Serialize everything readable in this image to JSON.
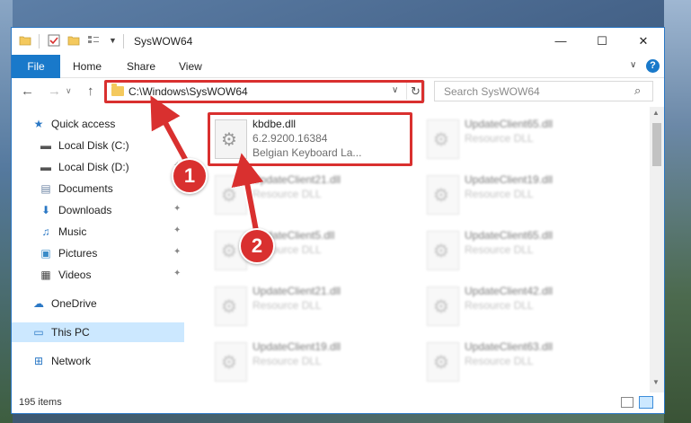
{
  "window": {
    "title": "SysWOW64",
    "controls": {
      "minimize": "—",
      "maximize": "☐",
      "close": "✕"
    }
  },
  "ribbon": {
    "file": "File",
    "tabs": [
      "Home",
      "Share",
      "View"
    ]
  },
  "nav": {
    "address": "C:\\Windows\\SysWOW64",
    "search_placeholder": "Search SysWOW64"
  },
  "sidebar": {
    "items": [
      {
        "label": "Quick access",
        "icon": "star-icon"
      },
      {
        "label": "Local Disk (C:)",
        "icon": "drive-icon"
      },
      {
        "label": "Local Disk (D:)",
        "icon": "drive-icon"
      },
      {
        "label": "Documents",
        "icon": "documents-icon"
      },
      {
        "label": "Downloads",
        "icon": "downloads-icon"
      },
      {
        "label": "Music",
        "icon": "music-icon"
      },
      {
        "label": "Pictures",
        "icon": "pictures-icon"
      },
      {
        "label": "Videos",
        "icon": "videos-icon"
      },
      {
        "label": "OneDrive",
        "icon": "onedrive-icon"
      },
      {
        "label": "This PC",
        "icon": "this-pc-icon"
      },
      {
        "label": "Network",
        "icon": "network-icon"
      }
    ]
  },
  "files": [
    {
      "name": "kbdbe.dll",
      "meta1": "6.2.9200.16384",
      "meta2": "Belgian Keyboard La..."
    },
    {
      "name": "UpdateClient65.dll",
      "meta1": "Resource DLL"
    },
    {
      "name": "UpdateClient21.dll",
      "meta1": "Resource DLL"
    },
    {
      "name": "UpdateClient19.dll",
      "meta1": "Resource DLL"
    },
    {
      "name": "UpdateClient5.dll",
      "meta1": "Resource DLL"
    },
    {
      "name": "UpdateClient65.dll",
      "meta1": "Resource DLL"
    },
    {
      "name": "UpdateClient21.dll",
      "meta1": "Resource DLL"
    },
    {
      "name": "UpdateClient42.dll",
      "meta1": "Resource DLL"
    },
    {
      "name": "UpdateClient19.dll",
      "meta1": "Resource DLL"
    },
    {
      "name": "UpdateClient63.dll",
      "meta1": "Resource DLL"
    }
  ],
  "status": {
    "items": "195 items"
  },
  "callouts": {
    "one": "1",
    "two": "2"
  },
  "colors": {
    "accent": "#1979ca",
    "highlight": "#d9302f",
    "selected": "#cce8ff"
  }
}
